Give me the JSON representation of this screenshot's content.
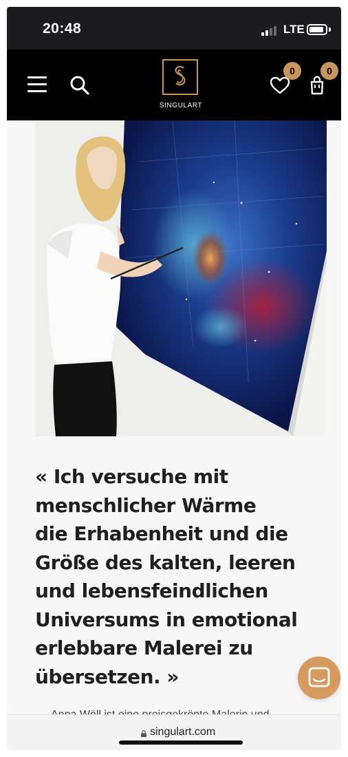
{
  "status_bar": {
    "time": "20:48",
    "network": "LTE",
    "icons": [
      "signal-icon",
      "battery-icon"
    ]
  },
  "header": {
    "icons": [
      "menu-icon",
      "search-icon",
      "heart-icon",
      "shopping-bag-icon"
    ],
    "logo_text": "SINGULART",
    "wishlist_count": "0",
    "cart_count": "0",
    "accent_color": "#c8955c"
  },
  "artwork_image": {
    "icon": "artist-painting-photo"
  },
  "quote": {
    "lines": [
      "« Ich versuche mit",
      "menschlicher Wärme",
      "die Erhabenheit und die",
      "Größe des kalten, leeren",
      "und lebensfeindlichen",
      "Universums in emotional",
      "erlebbare Malerei zu",
      "übersetzen. »"
    ]
  },
  "cut_text": "Anna Wöll ist eine preisgekrönte Malerin und",
  "chat": {
    "icon": "chat-icon",
    "color": "#d79b5f"
  },
  "browser": {
    "url": "singulart.com",
    "icon": "lock-icon"
  }
}
